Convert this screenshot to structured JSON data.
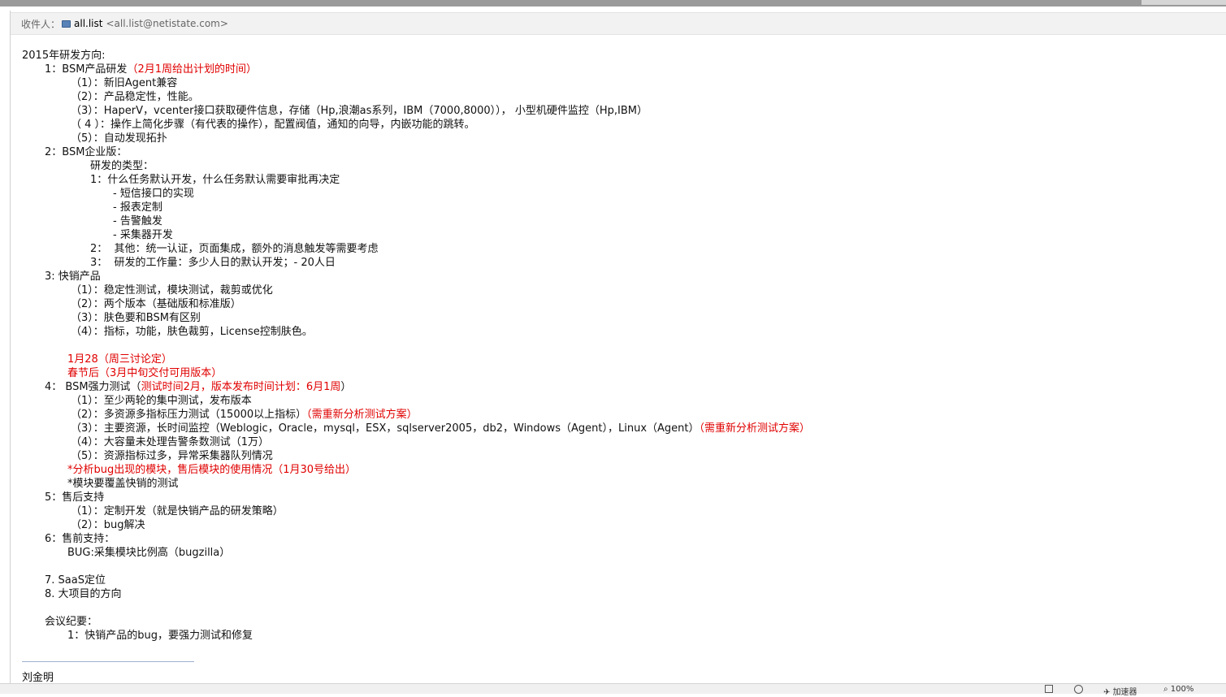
{
  "header": {
    "recipient_label": "收件人：",
    "recipient_name": "all.list",
    "recipient_address": "<all.list@netistate.com>"
  },
  "email": {
    "lines": [
      {
        "indent": 0,
        "text": "2015年研发方向:",
        "red": ""
      },
      {
        "indent": 28,
        "text": "1：BSM产品研发",
        "red": "（2月1周给出计划的时间）"
      },
      {
        "indent": 60,
        "text": "（1）：新旧Agent兼容",
        "red": ""
      },
      {
        "indent": 60,
        "text": "（2）：产品稳定性，性能。",
        "red": ""
      },
      {
        "indent": 60,
        "text": "（3）：HaperV，vcenter接口获取硬件信息，存储（Hp,浪潮as系列，IBM（7000,8000））， 小型机硬件监控（Hp,IBM）",
        "red": ""
      },
      {
        "indent": 60,
        "text": "（ 4 ）：操作上简化步骤（有代表的操作），配置阀值，通知的向导，内嵌功能的跳转。",
        "red": ""
      },
      {
        "indent": 60,
        "text": "（5）：自动发现拓扑",
        "red": ""
      },
      {
        "indent": 28,
        "text": "2：BSM企业版：",
        "red": ""
      },
      {
        "indent": 84,
        "text": "研发的类型：",
        "red": ""
      },
      {
        "indent": 84,
        "text": "1：什么任务默认开发，什么任务默认需要审批再决定",
        "red": ""
      },
      {
        "indent": 112,
        "text": "- 短信接口的实现",
        "red": ""
      },
      {
        "indent": 112,
        "text": "- 报表定制",
        "red": ""
      },
      {
        "indent": 112,
        "text": "- 告警触发",
        "red": ""
      },
      {
        "indent": 112,
        "text": "- 采集器开发",
        "red": ""
      },
      {
        "indent": 84,
        "text": "2：  其他：统一认证，页面集成，额外的消息触发等需要考虑",
        "red": ""
      },
      {
        "indent": 84,
        "text": "3：  研发的工作量：多少人日的默认开发；- 20人日",
        "red": ""
      },
      {
        "indent": 28,
        "text": "3: 快销产品",
        "red": ""
      },
      {
        "indent": 60,
        "text": "（1）：稳定性测试，模块测试，裁剪或优化",
        "red": ""
      },
      {
        "indent": 60,
        "text": "（2）：两个版本（基础版和标准版）",
        "red": ""
      },
      {
        "indent": 60,
        "text": "（3）：肤色要和BSM有区别",
        "red": ""
      },
      {
        "indent": 60,
        "text": "（4）：指标，功能，肤色裁剪，License控制肤色。",
        "red": ""
      },
      {
        "indent": 0,
        "text": "",
        "red": ""
      },
      {
        "indent": 56,
        "text": "",
        "red": "1月28（周三讨论定）"
      },
      {
        "indent": 56,
        "text": "",
        "red": "春节后（3月中旬交付可用版本）"
      },
      {
        "indent": 28,
        "text": "4： BSM强力测试（",
        "red": "测试时间2月，版本发布时间计划：6月1周",
        "tail": "）"
      },
      {
        "indent": 60,
        "text": "（1）：至少两轮的集中测试，发布版本",
        "red": ""
      },
      {
        "indent": 60,
        "text": "（2）：多资源多指标压力测试（15000以上指标）",
        "red": "（需重新分析测试方案）"
      },
      {
        "indent": 60,
        "text": "（3）：主要资源，长时间监控（Weblogic，Oracle，mysql，ESX，sqlserver2005，db2，Windows（Agent），Linux（Agent）",
        "red": "（需重新分析测试方案）"
      },
      {
        "indent": 60,
        "text": "（4）：大容量未处理告警条数测试（1万）",
        "red": ""
      },
      {
        "indent": 60,
        "text": "（5）：资源指标过多，异常采集器队列情况",
        "red": ""
      },
      {
        "indent": 56,
        "text": "",
        "red": "*分析bug出现的模块，售后模块的使用情况（1月30号给出）"
      },
      {
        "indent": 56,
        "text": "*模块要覆盖快销的测试",
        "red": ""
      },
      {
        "indent": 28,
        "text": "5：售后支持",
        "red": ""
      },
      {
        "indent": 60,
        "text": "（1）：定制开发（就是快销产品的研发策略）",
        "red": ""
      },
      {
        "indent": 60,
        "text": "（2）：bug解决",
        "red": ""
      },
      {
        "indent": 28,
        "text": "6：售前支持：",
        "red": ""
      },
      {
        "indent": 56,
        "text": "BUG:采集模块比例高（bugzilla）",
        "red": ""
      },
      {
        "indent": 0,
        "text": "",
        "red": ""
      },
      {
        "indent": 28,
        "text": "7. SaaS定位",
        "red": ""
      },
      {
        "indent": 28,
        "text": "8. 大项目的方向",
        "red": ""
      },
      {
        "indent": 0,
        "text": "",
        "red": ""
      },
      {
        "indent": 28,
        "text": "会议纪要：",
        "red": ""
      },
      {
        "indent": 56,
        "text": "1：快销产品的bug，要强力测试和修复",
        "red": ""
      }
    ],
    "signature": "刘金明"
  },
  "statusbar": {
    "accelerator_label": "加速器",
    "zoom": "100%"
  }
}
